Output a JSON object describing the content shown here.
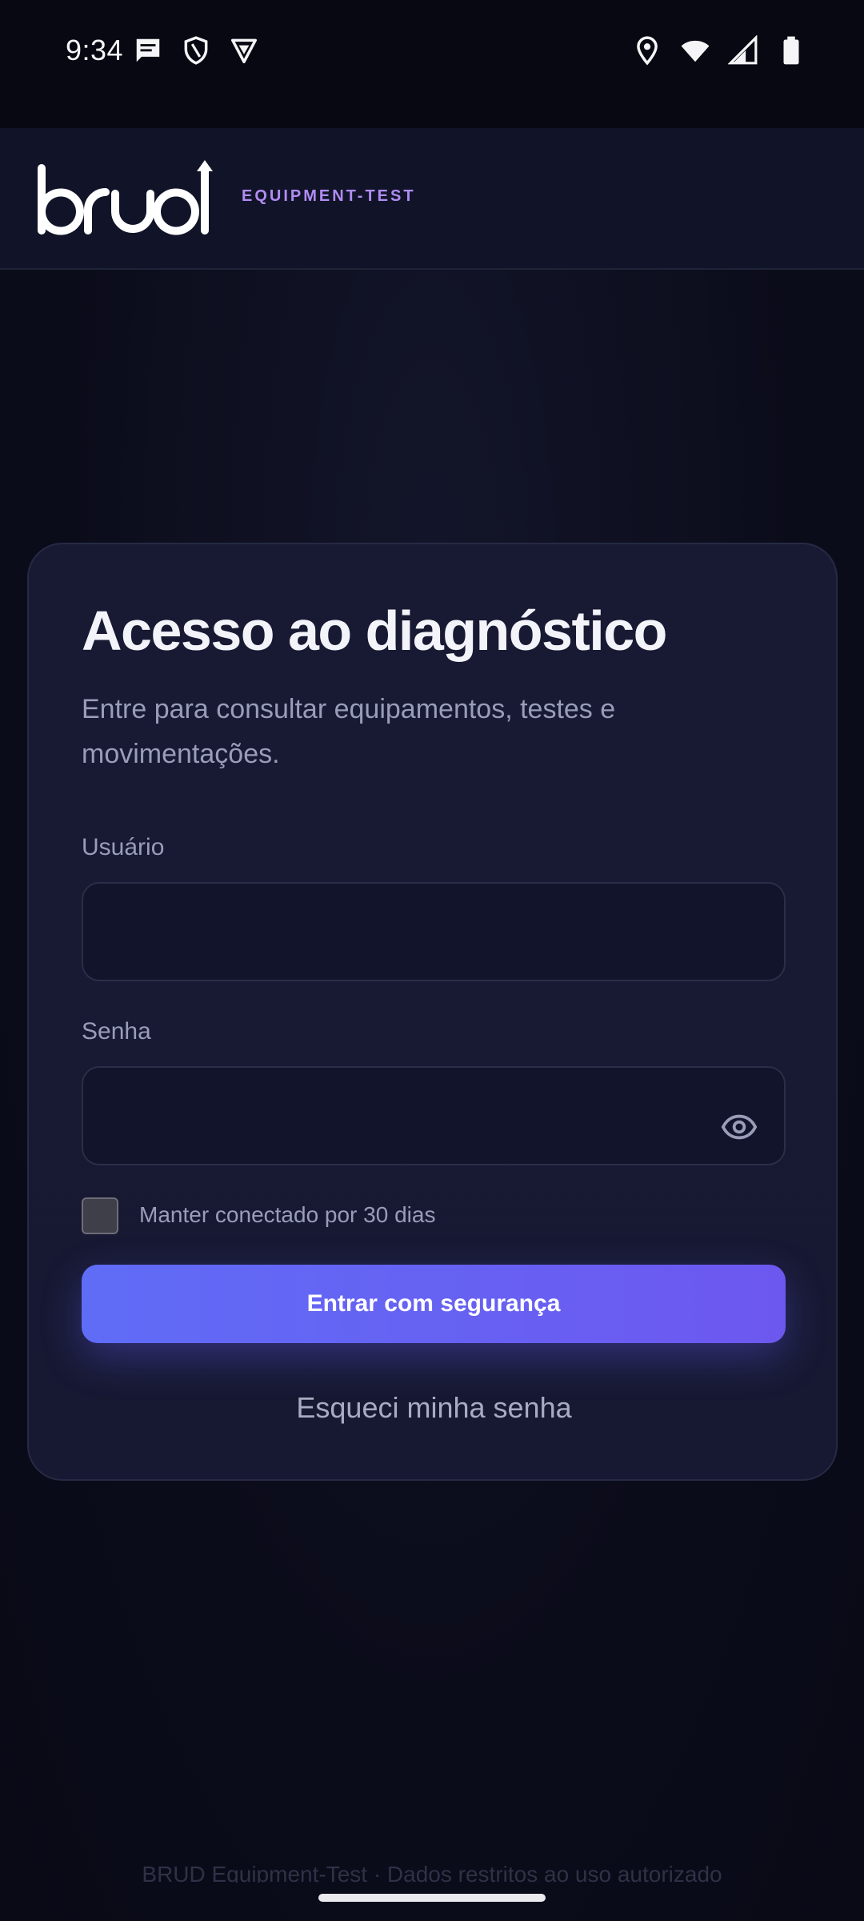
{
  "status_bar": {
    "time": "9:34",
    "left_icons": [
      "message-icon",
      "shield-icon",
      "vpn-icon"
    ],
    "right_icons": [
      "location-icon",
      "wifi-icon",
      "signal-icon",
      "battery-icon"
    ]
  },
  "header": {
    "logo_text": "brud",
    "tag": "EQUIPMENT-TEST"
  },
  "login": {
    "title": "Acesso ao diagnóstico",
    "subtitle": "Entre para consultar equipamentos, testes e movimentações.",
    "username_label": "Usuário",
    "username_value": "",
    "password_label": "Senha",
    "password_value": "",
    "remember_label": "Manter conectado por 30 dias",
    "remember_checked": false,
    "submit_label": "Entrar com segurança",
    "forgot_label": "Esqueci minha senha"
  },
  "footer": {
    "text": "BRUD Equipment-Test · Dados restritos ao uso autorizado"
  },
  "colors": {
    "background": "#0b0c1a",
    "card": "#181a33",
    "accent_start": "#5f6cf6",
    "accent_end": "#6d58ef",
    "tag": "#b18cf5"
  }
}
